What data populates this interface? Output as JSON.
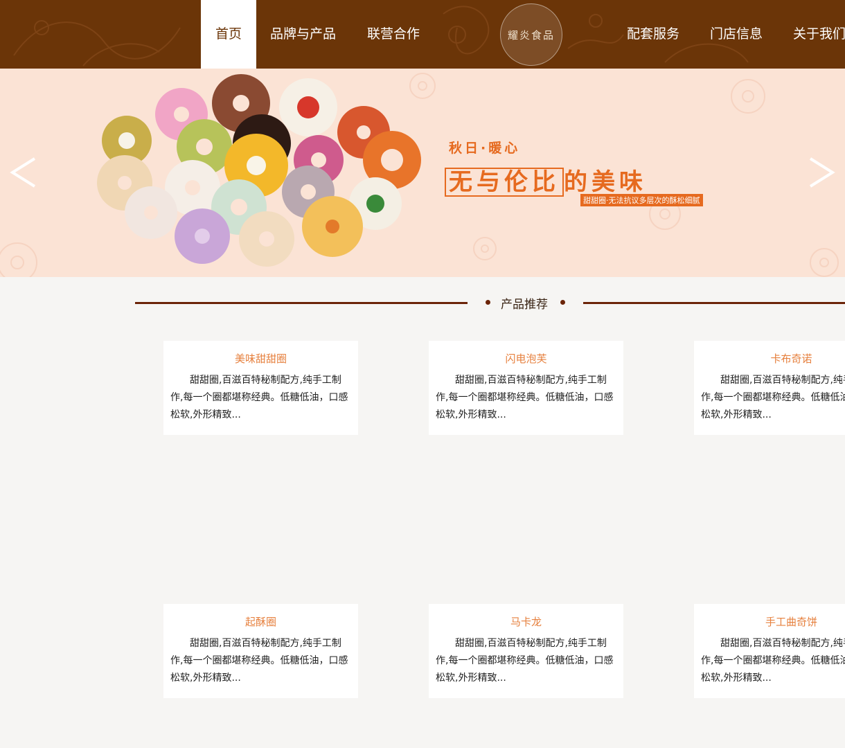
{
  "nav": {
    "items": [
      {
        "label": "首页",
        "active": true
      },
      {
        "label": "品牌与产品"
      },
      {
        "label": "联营合作"
      },
      {
        "label": "配套服务"
      },
      {
        "label": "门店信息"
      },
      {
        "label": "关于我们"
      }
    ],
    "logo_text": "耀炎食品"
  },
  "banner": {
    "slogan_top": "秋日·暖心",
    "slogan_boxed": "无与伦比",
    "slogan_rest": "的美味",
    "slogan_sub": "甜甜圈·无法抗议多层次的酥松细腻",
    "prev_icon": "chevron-left-icon",
    "next_icon": "chevron-right-icon"
  },
  "section": {
    "title": "产品推荐"
  },
  "products": [
    {
      "title": "美味甜甜圈",
      "desc": "甜甜圈,百滋百特秘制配方,纯手工制 作,每一个圈都堪称经典。低糖低油，口感 松软,外形精致..."
    },
    {
      "title": "闪电泡芙",
      "desc": "甜甜圈,百滋百特秘制配方,纯手工制 作,每一个圈都堪称经典。低糖低油，口感 松软,外形精致..."
    },
    {
      "title": "卡布奇诺",
      "desc": "甜甜圈,百滋百特秘制配方,纯手工制 作,每一个圈都堪称经典。低糖低油，口感 松软,外形精致..."
    },
    {
      "title": "起酥圈",
      "desc": "甜甜圈,百滋百特秘制配方,纯手工制 作,每一个圈都堪称经典。低糖低油，口感 松软,外形精致..."
    },
    {
      "title": "马卡龙",
      "desc": "甜甜圈,百滋百特秘制配方,纯手工制 作,每一个圈都堪称经典。低糖低油，口感 松软,外形精致..."
    },
    {
      "title": "手工曲奇饼",
      "desc": "甜甜圈,百滋百特秘制配方,纯手工制 作,每一个圈都堪称经典。低糖低油，口感 松软,外形精致..."
    }
  ],
  "colors": {
    "header_bg": "#6b3508",
    "banner_bg": "#fbe3d5",
    "accent_orange": "#e66a1f",
    "card_title": "#e6803e",
    "section_line": "#6b2408"
  }
}
